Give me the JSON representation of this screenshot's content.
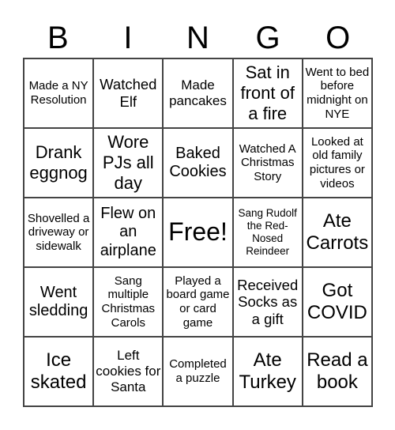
{
  "header": [
    "B",
    "I",
    "N",
    "G",
    "O"
  ],
  "cells": [
    "Made a NY Resolution",
    "Watched Elf",
    "Made pancakes",
    "Sat in front of a fire",
    "Went to bed before midnight on NYE",
    "Drank eggnog",
    "Wore PJs all day",
    "Baked Cookies",
    "Watched A Christmas Story",
    "Looked at old family pictures or videos",
    "Shovelled a driveway or sidewalk",
    "Flew on an airplane",
    "Free!",
    "Sang Rudolf the Red-Nosed Reindeer",
    "Ate Carrots",
    "Went sledding",
    "Sang multiple Christmas Carols",
    "Played a board game or card game",
    "Received Socks as a gift",
    "Got COVID",
    "Ice skated",
    "Left cookies for Santa",
    "Completed a puzzle",
    "Ate Turkey",
    "Read a book"
  ]
}
